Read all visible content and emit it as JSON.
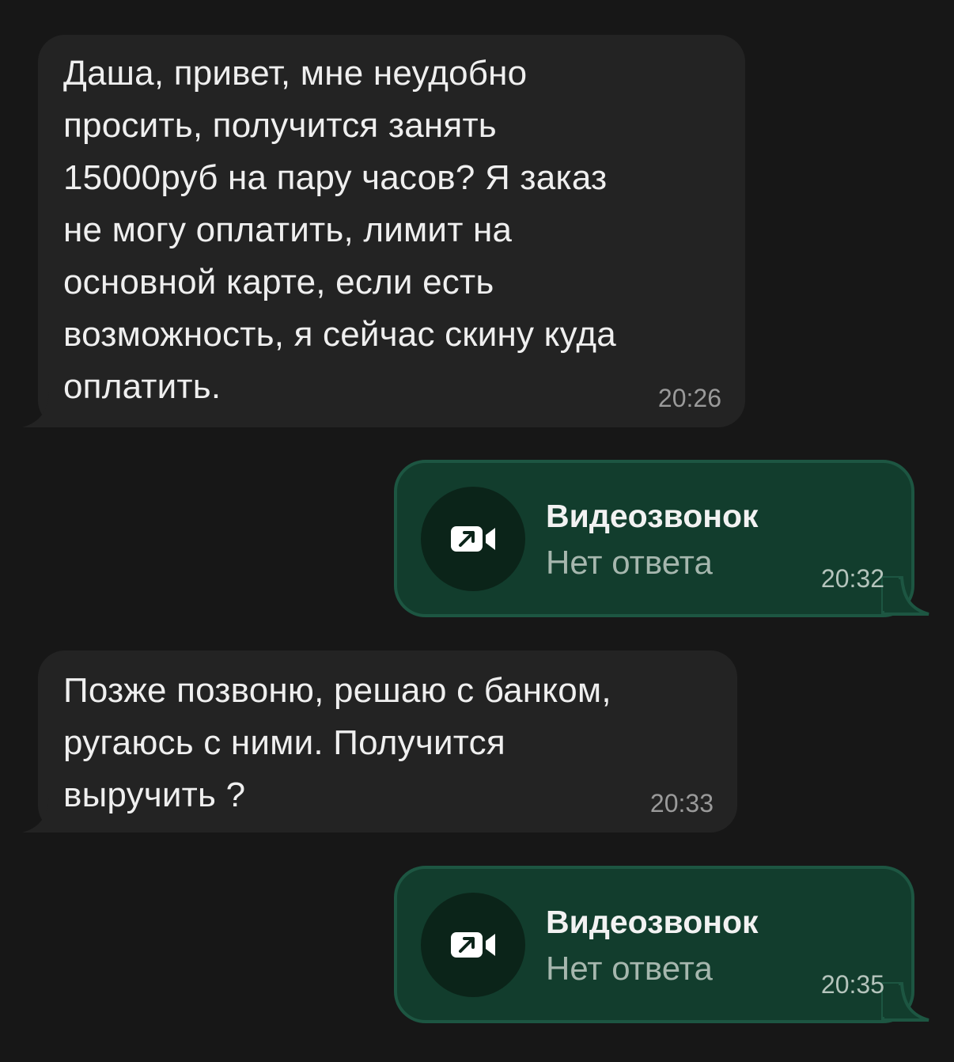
{
  "colors": {
    "background": "#171717",
    "incoming_bubble": "#232323",
    "outgoing_bubble": "#123d2d",
    "outgoing_border": "#1d5642"
  },
  "messages": [
    {
      "direction": "incoming",
      "text": "Даша, привет, мне неудобно\nпросить, получится занять\n15000руб на пару часов? Я заказ\nне могу оплатить, лимит на\nосновной карте, если есть\nвозможность, я сейчас скину куда\nоплатить.",
      "time": "20:26"
    },
    {
      "direction": "outgoing",
      "type": "call",
      "icon": "outgoing-video-call-icon",
      "title": "Видеозвонок",
      "status": "Нет ответа",
      "time": "20:32"
    },
    {
      "direction": "incoming",
      "text": "Позже позвоню, решаю с банком,\nругаюсь с ними. Получится\nвыручить ?",
      "time": "20:33"
    },
    {
      "direction": "outgoing",
      "type": "call",
      "icon": "outgoing-video-call-icon",
      "title": "Видеозвонок",
      "status": "Нет ответа",
      "time": "20:35"
    }
  ]
}
